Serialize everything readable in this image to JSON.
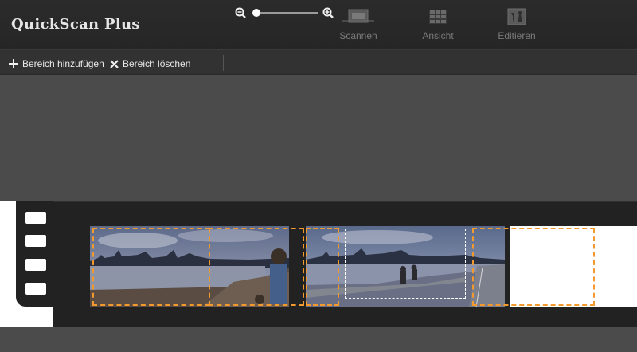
{
  "app": {
    "title": "QuickScan Plus"
  },
  "modes": [
    {
      "label": "Scannen",
      "icon": "scanner-icon"
    },
    {
      "label": "Ansicht",
      "icon": "grid-view-icon"
    },
    {
      "label": "Editieren",
      "icon": "edit-tools-icon"
    }
  ],
  "toolbar": {
    "add_area_label": "Bereich hinzufügen",
    "delete_area_label": "Bereich löschen",
    "zoom_out_icon": "zoom-out-icon",
    "zoom_in_icon": "zoom-in-icon",
    "zoom_level": 0.05
  },
  "colors": {
    "selection": "#f39a2e",
    "active_selection": "#ffffff",
    "header_bg": "#262626",
    "canvas_bg": "#4b4b4b"
  }
}
